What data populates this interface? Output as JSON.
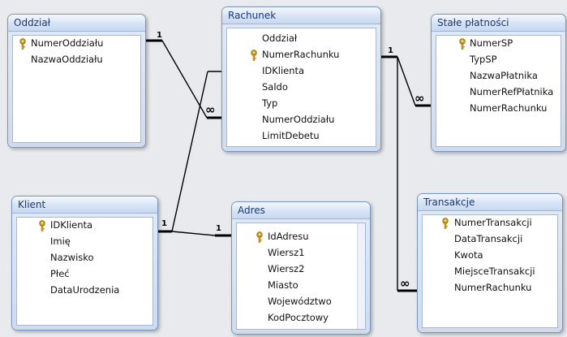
{
  "tables": {
    "oddzial": {
      "title": "Oddział",
      "fields": [
        "NumerOddziału",
        "NazwaOddziału"
      ]
    },
    "rachunek": {
      "title": "Rachunek",
      "fields": [
        "Oddział",
        "NumerRachunku",
        "IDKlienta",
        "Saldo",
        "Typ",
        "NumerOddziału",
        "LimitDebetu"
      ]
    },
    "stale": {
      "title": "Stałe płatności",
      "fields": [
        "NumerSP",
        "TypSP",
        "NazwaPłatnika",
        "NumerRefPłatnika",
        "NumerRachunku"
      ]
    },
    "klient": {
      "title": "Klient",
      "fields": [
        "IDKlienta",
        "Imię",
        "Nazwisko",
        "Płeć",
        "DataUrodzenia"
      ]
    },
    "adres": {
      "title": "Adres",
      "fields": [
        "IdAdresu",
        "Wiersz1",
        "Wiersz2",
        "Miasto",
        "Województwo",
        "KodPocztowy"
      ]
    },
    "transakcje": {
      "title": "Transakcje",
      "fields": [
        "NumerTransakcji",
        "DataTransakcji",
        "Kwota",
        "MiejsceTransakcji",
        "NumerRachunku"
      ]
    }
  },
  "relations": {
    "one": "1",
    "many": "∞"
  },
  "icons": {
    "primary_key": "key-icon"
  },
  "colors": {
    "canvas": "#e8eaed",
    "title_text": "#1f3a6e",
    "border": "#7a96c2",
    "key": "#d4a017"
  }
}
